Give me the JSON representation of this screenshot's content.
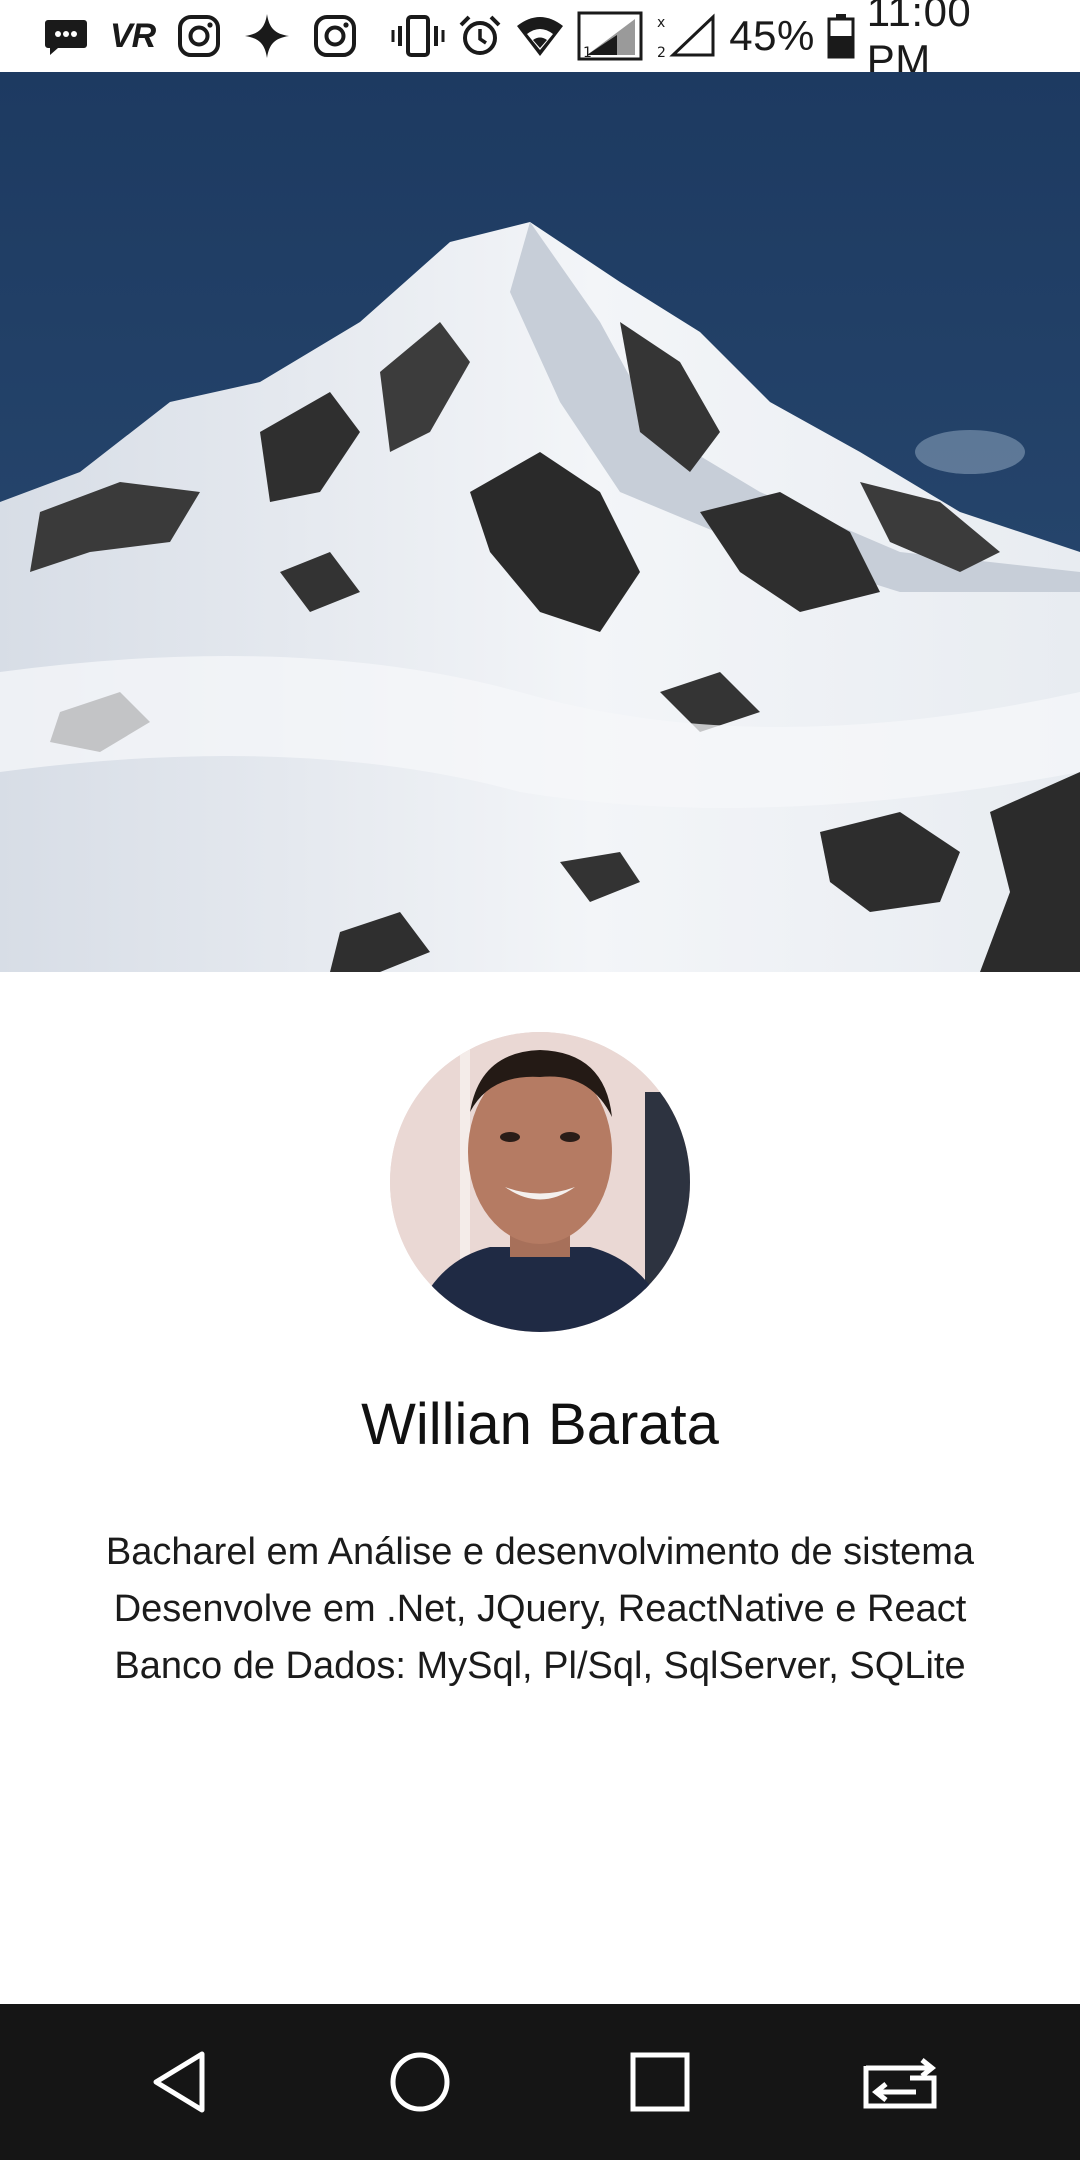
{
  "status_bar": {
    "left_icons": [
      "messages-icon",
      "vr-icon",
      "instagram-icon",
      "sparkle-icon",
      "instagram-icon"
    ],
    "vr_text": "VR",
    "right_icons": [
      "vibrate-icon",
      "alarm-icon",
      "wifi-icon",
      "signal-sim1-icon",
      "signal-sim2-icon",
      "battery-icon"
    ],
    "battery_percent": "45%",
    "time": "11:00 PM"
  },
  "cover": {
    "subject": "snowy-mountain-photo",
    "sky_color": "#1f3a5e"
  },
  "profile": {
    "avatar_icon": "profile-photo",
    "name": "Willian Barata",
    "bio": [
      "Bacharel em Análise e desenvolvimento de sistema",
      "Desenvolve em .Net, JQuery, ReactNative e React",
      "Banco de Dados: MySql, Pl/Sql, SqlServer, SQLite"
    ]
  },
  "nav_bar": {
    "buttons": [
      "back-icon",
      "home-icon",
      "recents-icon",
      "dual-window-icon"
    ],
    "background": "#151515"
  }
}
